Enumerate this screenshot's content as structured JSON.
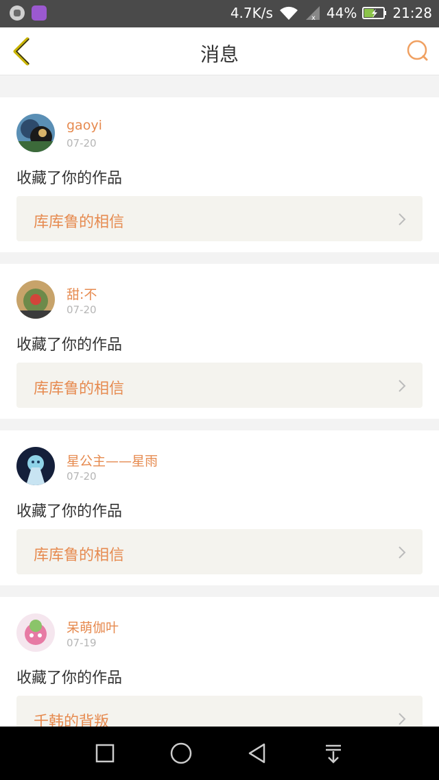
{
  "status_bar": {
    "speed": "4.7K/s",
    "battery": "44%",
    "time": "21:28"
  },
  "header": {
    "title": "消息"
  },
  "colors": {
    "accent": "#e68a4f",
    "back_arrow": "#c9b400",
    "card_link_bg": "#f4f3ee"
  },
  "messages": [
    {
      "user": "gaoyi",
      "date": "07-20",
      "action": "收藏了你的作品",
      "work": "库库鲁的相信"
    },
    {
      "user": "甜:不",
      "date": "07-20",
      "action": "收藏了你的作品",
      "work": "库库鲁的相信"
    },
    {
      "user": "星公主——星雨",
      "date": "07-20",
      "action": "收藏了你的作品",
      "work": "库库鲁的相信"
    },
    {
      "user": "呆萌伽叶",
      "date": "07-19",
      "action": "收藏了你的作品",
      "work": "千韩的背叛"
    }
  ]
}
